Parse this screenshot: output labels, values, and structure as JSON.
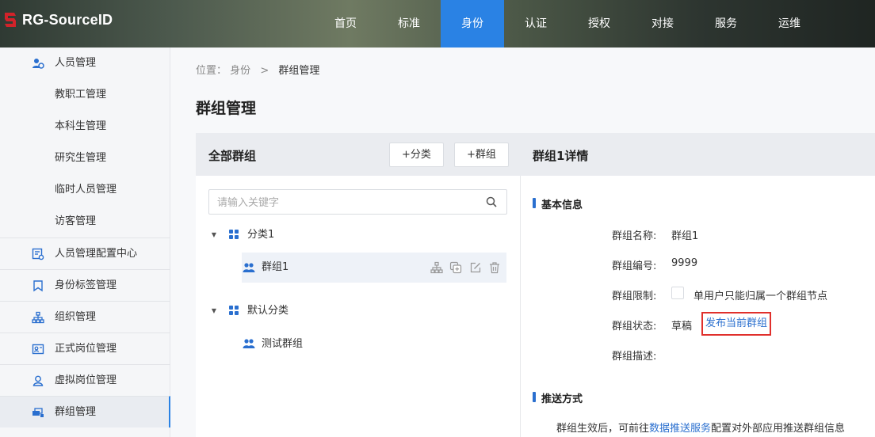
{
  "header": {
    "logo_text": "RG-SourceID",
    "nav": [
      "首页",
      "标准",
      "身份",
      "认证",
      "授权",
      "对接",
      "服务",
      "运维"
    ],
    "active_nav": "身份",
    "brand_color": "#d2232a",
    "accent_color": "#2a82e4"
  },
  "sidebar": {
    "items": [
      {
        "label": "人员管理",
        "icon": "user-admin-icon",
        "type": "parent"
      },
      {
        "label": "教职工管理",
        "type": "child"
      },
      {
        "label": "本科生管理",
        "type": "child"
      },
      {
        "label": "研究生管理",
        "type": "child"
      },
      {
        "label": "临时人员管理",
        "type": "child"
      },
      {
        "label": "访客管理",
        "type": "child"
      },
      {
        "label": "人员管理配置中心",
        "icon": "config-center-icon",
        "type": "parent"
      },
      {
        "label": "身份标签管理",
        "icon": "bookmark-icon",
        "type": "parent"
      },
      {
        "label": "组织管理",
        "icon": "org-tree-icon",
        "type": "parent"
      },
      {
        "label": "正式岗位管理",
        "icon": "id-card-icon",
        "type": "parent"
      },
      {
        "label": "虚拟岗位管理",
        "icon": "virtual-user-icon",
        "type": "parent"
      },
      {
        "label": "群组管理",
        "icon": "group-icon",
        "type": "parent",
        "active": true
      }
    ]
  },
  "breadcrumb": {
    "prefix": "位置：",
    "parent": "身份",
    "sep": ">",
    "current": "群组管理"
  },
  "page_title": "群组管理",
  "left_panel": {
    "title": "全部群组",
    "add_category_label": "+分类",
    "add_group_label": "+群组",
    "search_placeholder": "请输入关键字",
    "tree": [
      {
        "category": "分类1",
        "groups": [
          "群组1"
        ]
      },
      {
        "category": "默认分类",
        "groups": [
          "测试群组"
        ]
      }
    ]
  },
  "right_panel": {
    "title": "群组1详情",
    "basic_info_title": "基本信息",
    "fields": {
      "name_label": "群组名称:",
      "name_value": "群组1",
      "code_label": "群组编号:",
      "code_value": "9999",
      "limit_label": "群组限制:",
      "limit_text": "单用户只能归属一个群组节点",
      "limit_checked": false,
      "status_label": "群组状态:",
      "status_value": "草稿",
      "publish_link": "发布当前群组",
      "desc_label": "群组描述:"
    },
    "push_title": "推送方式",
    "push_text_pre": "群组生效后，可前往",
    "push_link": "数据推送服务",
    "push_text_post": "配置对外部应用推送群组信息"
  }
}
